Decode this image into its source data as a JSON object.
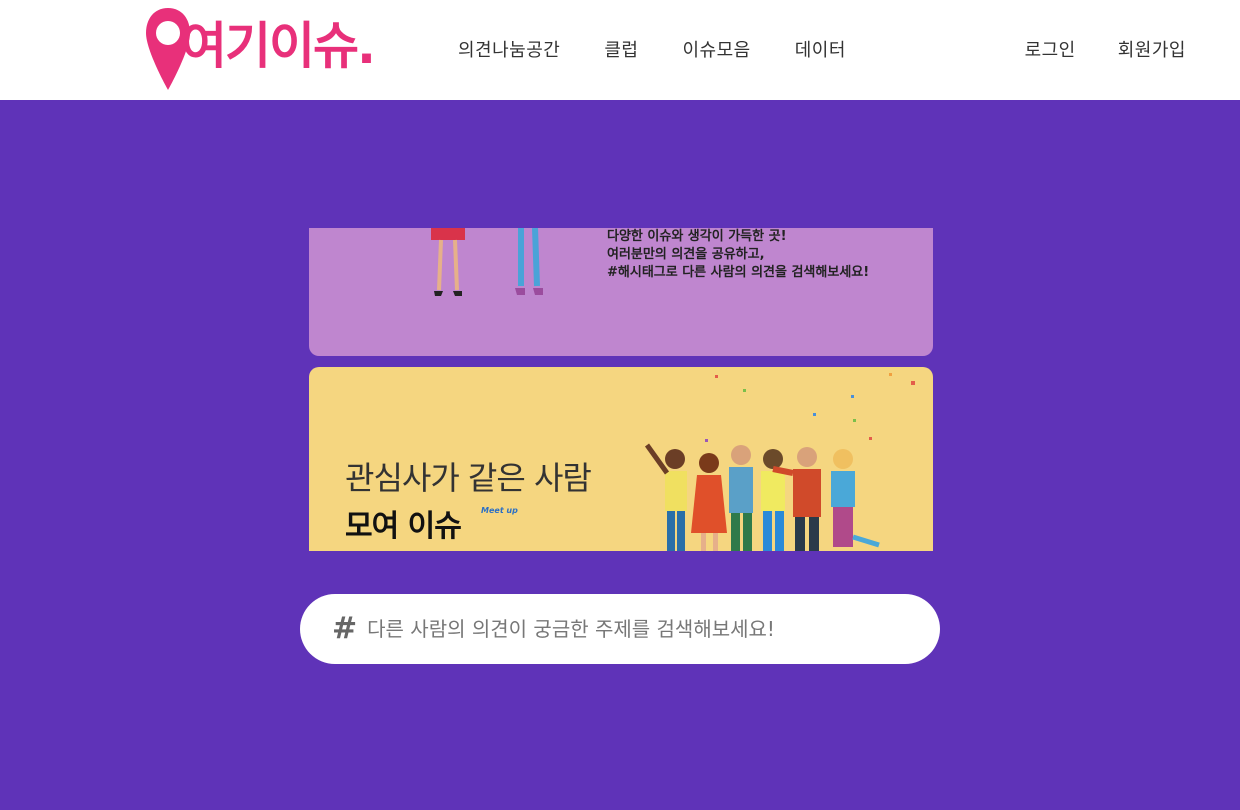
{
  "brand": {
    "logo_text": "여기이슈.",
    "color": "#e8307a"
  },
  "nav": {
    "items": [
      {
        "label": "의견나눔공간"
      },
      {
        "label": "클럽"
      },
      {
        "label": "이슈모음"
      },
      {
        "label": "데이터"
      }
    ]
  },
  "auth": {
    "login": "로그인",
    "signup": "회원가입"
  },
  "banners": {
    "purple": {
      "lines": [
        "다양한 이슈와 생각이 가득한 곳!",
        "여러분만의 의견을 공유하고,",
        "#해시태그로 다른 사람의 의견을 검색해보세요!"
      ],
      "color": "#bf86cf"
    },
    "yellow": {
      "title": "관심사가 같은 사람",
      "subtitle": "모여 이슈",
      "tag": "Meet up",
      "color": "#f5d680"
    }
  },
  "search": {
    "icon": "hash-icon",
    "placeholder": "다른 사람의 의견이 궁금한 주제를 검색해보세요!"
  },
  "colors": {
    "background": "#5f33b8",
    "header": "#ffffff"
  }
}
